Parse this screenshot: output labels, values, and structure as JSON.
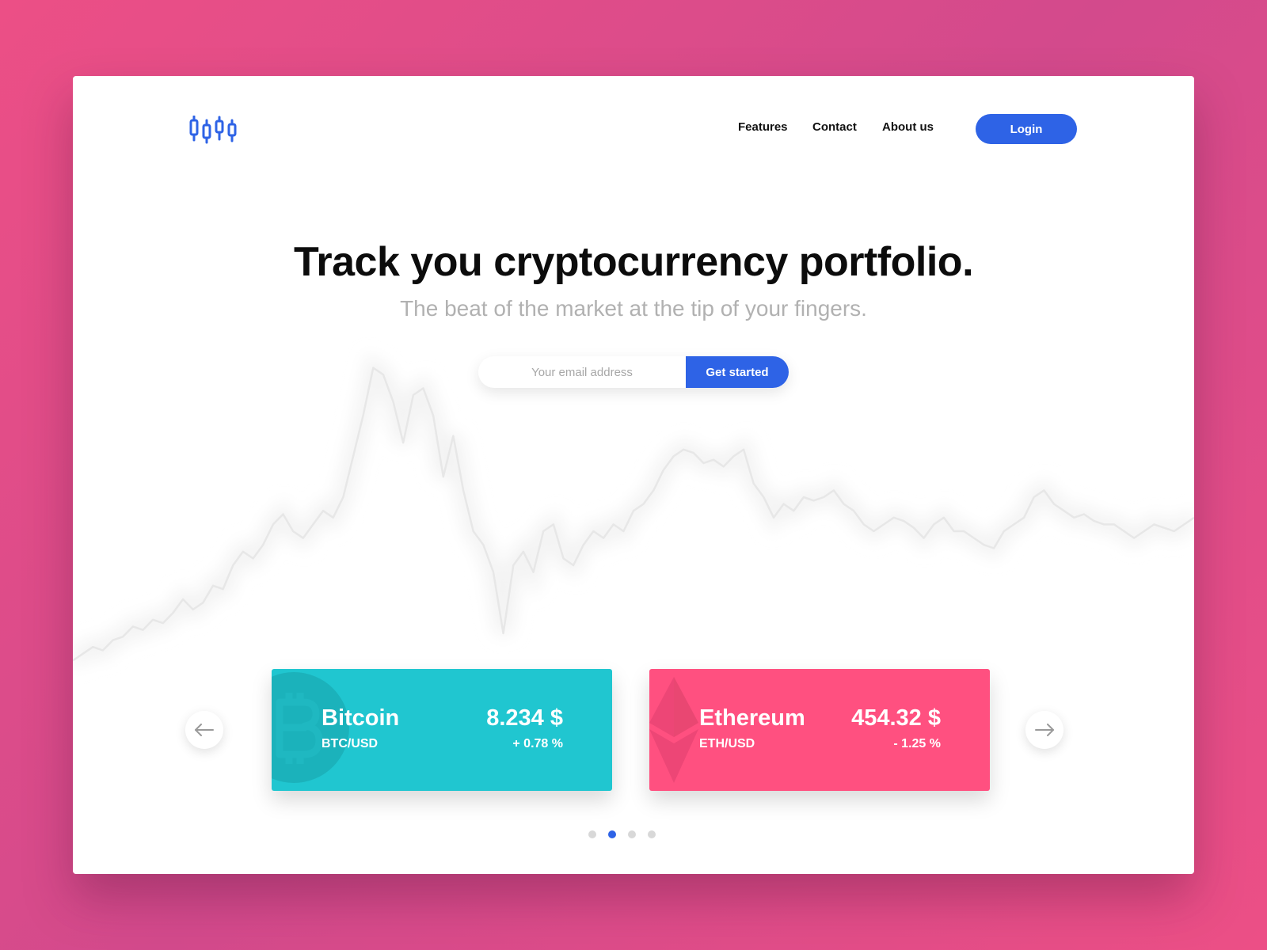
{
  "nav": {
    "logo_icon": "candlestick-chart-icon",
    "links": [
      "Features",
      "Contact",
      "About us"
    ],
    "login_label": "Login"
  },
  "hero": {
    "title": "Track you cryptocurrency portfolio.",
    "subtitle": "The beat of the market at the tip of your fingers.",
    "email_placeholder": "Your email address",
    "cta_label": "Get started"
  },
  "cards": [
    {
      "name": "Bitcoin",
      "pair": "BTC/USD",
      "price": "8.234 $",
      "change": "+ 0.78 %",
      "color": "#20c6d0",
      "icon": "bitcoin-icon"
    },
    {
      "name": "Ethereum",
      "pair": "ETH/USD",
      "price": "454.32 $",
      "change": "- 1.25 %",
      "color": "#ff5080",
      "icon": "ethereum-icon"
    }
  ],
  "carousel": {
    "prev_icon": "arrow-left-icon",
    "next_icon": "arrow-right-icon",
    "page_count": 4,
    "active_page": 2
  },
  "colors": {
    "accent": "#2e63e6",
    "background": "#e44f88",
    "chart_line": "#e7e7e7"
  },
  "chart_data": {
    "type": "line",
    "series": [
      {
        "values": [
          12,
          14,
          16,
          15,
          18,
          19,
          22,
          21,
          24,
          23,
          26,
          30,
          27,
          29,
          34,
          33,
          40,
          44,
          42,
          46,
          52,
          55,
          50,
          48,
          52,
          56,
          54,
          60,
          72,
          84,
          98,
          96,
          88,
          76,
          90,
          92,
          84,
          66,
          78,
          62,
          50,
          46,
          38,
          20,
          40,
          44,
          38,
          50,
          52,
          42,
          40,
          46,
          50,
          48,
          52,
          50,
          56,
          58,
          62,
          68,
          72,
          74,
          73,
          70,
          71,
          69,
          72,
          74,
          64,
          60,
          54,
          58,
          56,
          60,
          59,
          60,
          62,
          58,
          56,
          52,
          50,
          52,
          54,
          53,
          51,
          48,
          52,
          54,
          50,
          50,
          48,
          46,
          45,
          50,
          52,
          54,
          60,
          62,
          58,
          56,
          54,
          55,
          53,
          52,
          52,
          50,
          48,
          50,
          52,
          51,
          50,
          52,
          54
        ]
      }
    ]
  }
}
